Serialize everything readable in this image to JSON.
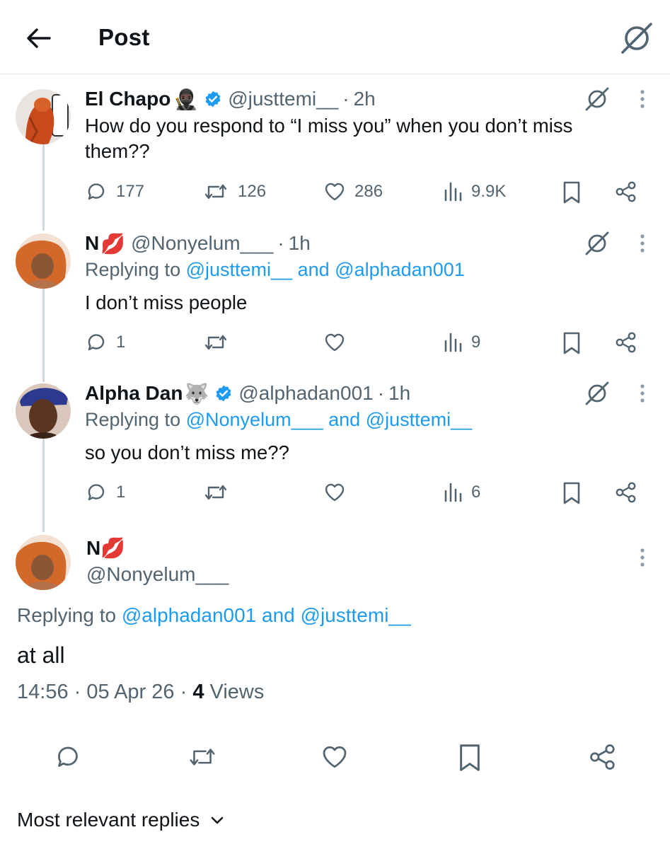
{
  "header": {
    "title": "Post",
    "back_icon": "back-arrow-icon",
    "grok_icon": "grok-icon"
  },
  "posts": [
    {
      "name": "El Chapo",
      "emoji": "🥷🏿",
      "verified": true,
      "handle": "@justtemi__",
      "time": "2h",
      "text": "How do you respond to “I miss you” when you don’t miss them??",
      "replies": "177",
      "reposts": "126",
      "likes": "286",
      "views": "9.9K"
    },
    {
      "name": "N",
      "emoji": "💋",
      "verified": false,
      "handle": "@Nonyelum___",
      "time": "1h",
      "replying_prefix": "Replying to",
      "replying_user1": "@justtemi__",
      "replying_and": "and",
      "replying_user2": "@alphadan001",
      "text": "I don’t miss people",
      "replies": "1",
      "reposts": "",
      "likes": "",
      "views": "9"
    },
    {
      "name": "Alpha Dan",
      "emoji": "🐺",
      "verified": true,
      "handle": "@alphadan001",
      "time": "1h",
      "replying_prefix": "Replying to",
      "replying_user1": "@Nonyelum___",
      "replying_and": "and",
      "replying_user2": "@justtemi__",
      "text": "so you don’t miss me??",
      "replies": "1",
      "reposts": "",
      "likes": "",
      "views": "6"
    }
  ],
  "focus": {
    "name": "N",
    "emoji": "💋",
    "handle": "@Nonyelum___",
    "replying_prefix": "Replying to",
    "replying_user1": "@alphadan001",
    "replying_and": "and",
    "replying_user2": "@justtemi__",
    "text": "at all",
    "time": "14:56",
    "date": "05 Apr 26",
    "views_count": "4",
    "views_label": "Views"
  },
  "sort_label": "Most relevant replies",
  "colors": {
    "link": "#1d9bf0",
    "secondary": "#536471",
    "verified": "#1d9bf0",
    "divider": "#e6e9ec"
  }
}
